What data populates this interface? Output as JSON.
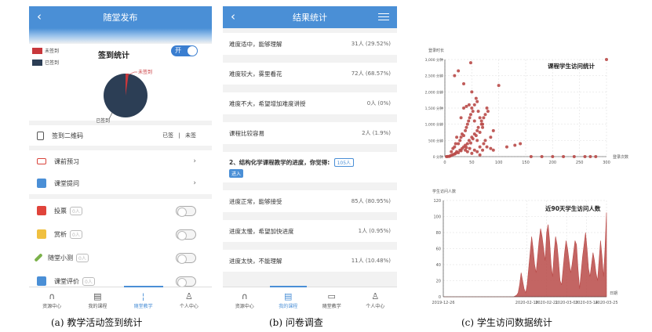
{
  "panel_a": {
    "title": "随堂发布",
    "legend_unsigned": "未签到",
    "legend_signed": "已签到",
    "sign_title": "签到统计",
    "toggle": "开",
    "pie_unsigned": "未签到",
    "pie_signed": "已签到",
    "qr_label": "签到二维码",
    "qr_signed": "已签",
    "qr_sep": "|",
    "qr_unsigned": "未签",
    "menu": [
      {
        "label": "课前预习",
        "icon": "preview-icon",
        "color": "#d9443b"
      },
      {
        "label": "课堂提问",
        "icon": "question-icon",
        "color": "#4a8fd6"
      }
    ],
    "activities": [
      {
        "label": "投票",
        "badge": "0人",
        "icon": "vote-icon",
        "color": "#e0443b"
      },
      {
        "label": "赏析",
        "badge": "0人",
        "icon": "appreciate-icon",
        "color": "#f0c040"
      },
      {
        "label": "随堂小测",
        "badge": "0人",
        "icon": "quiz-icon",
        "color": "#7bb14a"
      },
      {
        "label": "课堂评价",
        "badge": "0人",
        "icon": "evaluate-icon",
        "color": "#4a8fd6"
      }
    ],
    "tabs": [
      "资源中心",
      "我的课程",
      "随堂教学",
      "个人中心"
    ],
    "active_tab": 2
  },
  "panel_b": {
    "title": "结果统计",
    "q1_rows": [
      {
        "label": "难度适中，能够理解",
        "count": "31人 (29.52%)"
      },
      {
        "label": "难度较大，雾里看花",
        "count": "72人 (68.57%)"
      },
      {
        "label": "难度不大，希望增加难度讲授",
        "count": "0人 (0%)"
      },
      {
        "label": "课程比较容易",
        "count": "2人 (1.9%)"
      }
    ],
    "q2_title": "2、结构化学课程教学的进度，你觉得:",
    "q2_num": "105人",
    "q2_enter": "进入",
    "q2_rows": [
      {
        "label": "进度正常，能够接受",
        "count": "85人 (80.95%)"
      },
      {
        "label": "进度太慢，希望加快进度",
        "count": "1人 (0.95%)"
      },
      {
        "label": "进度太快，不能理解",
        "count": "11人 (10.48%)"
      }
    ],
    "tabs": [
      "资源中心",
      "我的课程",
      "随堂教学",
      "个人中心"
    ],
    "active_tab": 1
  },
  "captions": {
    "a": "(a)  教学活动签到统计",
    "b": "(b)  问卷调查",
    "c": "(c)  学生访问数据统计"
  },
  "chart_data": [
    {
      "type": "scatter",
      "title": "课程学生访问统计",
      "ylabel": "登录时长",
      "xlabel": "登录次数",
      "xlim": [
        0,
        300
      ],
      "ylim": [
        0,
        3000
      ],
      "xticks": [
        "0",
        "50",
        "100",
        "150",
        "200",
        "250",
        "300"
      ],
      "yticks": [
        "0 分钟",
        "500 分钟",
        "1,000 分钟",
        "1,500 分钟",
        "2,000 分钟",
        "2,500 分钟",
        "3,000 分钟"
      ],
      "color": "#b94a48",
      "points": [
        [
          3,
          0
        ],
        [
          5,
          2
        ],
        [
          8,
          5
        ],
        [
          10,
          20
        ],
        [
          12,
          40
        ],
        [
          15,
          60
        ],
        [
          18,
          80
        ],
        [
          20,
          100
        ],
        [
          22,
          150
        ],
        [
          25,
          120
        ],
        [
          28,
          200
        ],
        [
          30,
          180
        ],
        [
          32,
          250
        ],
        [
          35,
          300
        ],
        [
          38,
          350
        ],
        [
          40,
          280
        ],
        [
          42,
          400
        ],
        [
          45,
          500
        ],
        [
          48,
          420
        ],
        [
          50,
          600
        ],
        [
          52,
          550
        ],
        [
          55,
          700
        ],
        [
          58,
          650
        ],
        [
          60,
          800
        ],
        [
          62,
          900
        ],
        [
          65,
          750
        ],
        [
          68,
          1100
        ],
        [
          70,
          1000
        ],
        [
          72,
          1200
        ],
        [
          75,
          1300
        ],
        [
          78,
          1500
        ],
        [
          80,
          1400
        ],
        [
          25,
          400
        ],
        [
          28,
          500
        ],
        [
          30,
          600
        ],
        [
          32,
          700
        ],
        [
          35,
          650
        ],
        [
          38,
          800
        ],
        [
          40,
          900
        ],
        [
          42,
          1000
        ],
        [
          44,
          1100
        ],
        [
          46,
          1200
        ],
        [
          48,
          1300
        ],
        [
          50,
          1500
        ],
        [
          52,
          1400
        ],
        [
          55,
          1600
        ],
        [
          58,
          1800
        ],
        [
          60,
          1700
        ],
        [
          62,
          1400
        ],
        [
          65,
          1200
        ],
        [
          68,
          1000
        ],
        [
          70,
          900
        ],
        [
          30,
          1200
        ],
        [
          35,
          1500
        ],
        [
          40,
          1550
        ],
        [
          45,
          1600
        ],
        [
          50,
          2000
        ],
        [
          55,
          1100
        ],
        [
          60,
          500
        ],
        [
          65,
          300
        ],
        [
          70,
          200
        ],
        [
          20,
          400
        ],
        [
          22,
          600
        ],
        [
          18,
          300
        ],
        [
          15,
          250
        ],
        [
          12,
          150
        ],
        [
          38,
          200
        ],
        [
          42,
          150
        ],
        [
          46,
          250
        ],
        [
          50,
          100
        ],
        [
          55,
          200
        ],
        [
          60,
          150
        ],
        [
          65,
          50
        ],
        [
          72,
          400
        ],
        [
          78,
          300
        ],
        [
          85,
          250
        ],
        [
          90,
          200
        ],
        [
          48,
          2900
        ],
        [
          25,
          2650
        ],
        [
          18,
          2500
        ],
        [
          100,
          2200
        ],
        [
          35,
          2250
        ],
        [
          130,
          350
        ],
        [
          115,
          300
        ],
        [
          140,
          400
        ],
        [
          90,
          800
        ],
        [
          85,
          600
        ],
        [
          75,
          500
        ],
        [
          300,
          3000
        ],
        [
          260,
          0
        ],
        [
          270,
          0
        ],
        [
          280,
          0
        ],
        [
          180,
          0
        ],
        [
          200,
          0
        ],
        [
          220,
          0
        ],
        [
          240,
          0
        ],
        [
          160,
          0
        ]
      ]
    },
    {
      "type": "area",
      "title": "近90天学生访问人数",
      "ylabel": "学生访问人数",
      "xlabel": "日期",
      "ylim": [
        0,
        120
      ],
      "yticks": [
        "0",
        "20",
        "40",
        "60",
        "80",
        "100",
        "120"
      ],
      "xticks": [
        "2019-12-26",
        "2020-02-10",
        "2020-02-21",
        "2020-03-03",
        "2020-03-14",
        "2020-03-25"
      ],
      "color": "#b94a48",
      "values": [
        0,
        0,
        0,
        0,
        0,
        0,
        0,
        0,
        0,
        0,
        0,
        0,
        0,
        0,
        0,
        0,
        0,
        0,
        0,
        0,
        0,
        0,
        0,
        0,
        0,
        0,
        0,
        0,
        0,
        0,
        0,
        0,
        0,
        0,
        0,
        0,
        0,
        0,
        0,
        0,
        0,
        0,
        0,
        0,
        0,
        0,
        0,
        0,
        1,
        2,
        5,
        15,
        30,
        20,
        10,
        5,
        15,
        35,
        55,
        75,
        60,
        40,
        30,
        50,
        70,
        85,
        75,
        60,
        45,
        80,
        90,
        70,
        40,
        25,
        55,
        75,
        65,
        45,
        20,
        15,
        35,
        55,
        70,
        60,
        45,
        30,
        40,
        55,
        70,
        65,
        35,
        10,
        30,
        50,
        65,
        80,
        60,
        35,
        25,
        40,
        55,
        45,
        30,
        20,
        45,
        70,
        50,
        25,
        60,
        105
      ]
    }
  ]
}
